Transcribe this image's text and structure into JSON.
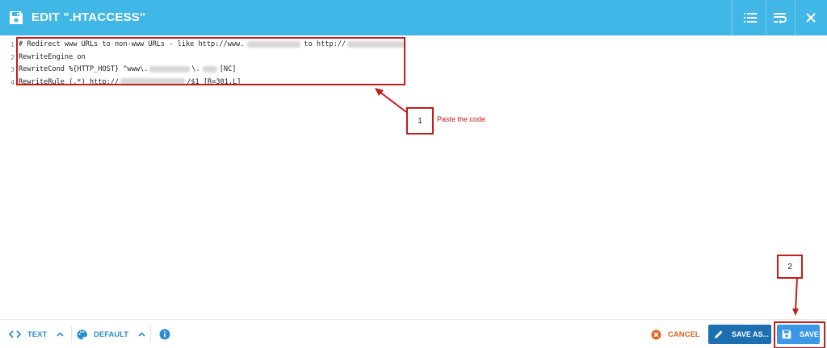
{
  "header": {
    "title": "EDIT \".HTACCESS\"",
    "bg_color": "#40b7e7",
    "icons": [
      "floppy-disk-icon",
      "list-icon",
      "wrap-icon",
      "close-icon"
    ]
  },
  "editor": {
    "lines": [
      {
        "num": "1",
        "parts": [
          "# Redirect www URLs to non-www URLs - like http://www.",
          "to http://"
        ]
      },
      {
        "num": "2",
        "parts": [
          "RewriteEngine on"
        ]
      },
      {
        "num": "3",
        "parts": [
          "RewriteCond %{HTTP_HOST} ^www\\.",
          "\\.",
          "[NC]"
        ]
      },
      {
        "num": "4",
        "parts": [
          "RewriteRule (.*) http://",
          "/$1 [R=301,L]"
        ]
      }
    ]
  },
  "annotations": {
    "callout1": {
      "num": "1",
      "text": "Paste the code"
    },
    "callout2": {
      "num": "2"
    },
    "color": "#c91a1a"
  },
  "footer": {
    "text_mode": "TEXT",
    "theme": "DEFAULT",
    "cancel_label": "CANCEL",
    "save_as_label": "SAVE AS...",
    "save_label": "SAVE",
    "accent_color": "#2a8fd0",
    "cancel_color": "#e2631d"
  }
}
